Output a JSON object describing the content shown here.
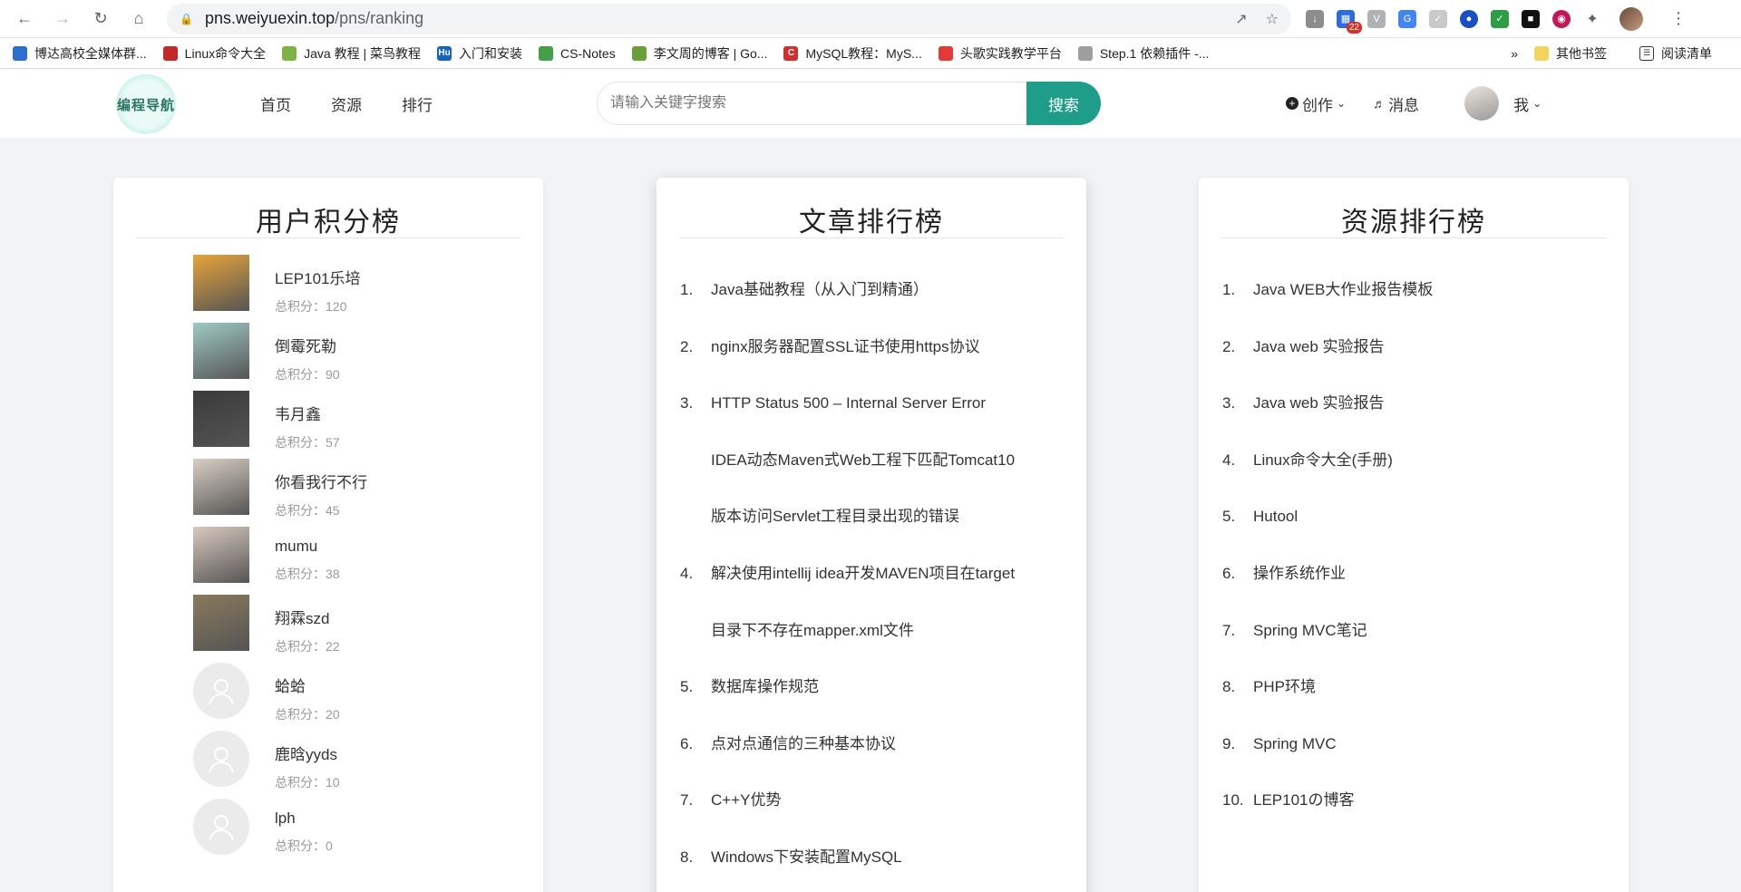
{
  "browser": {
    "url_host": "pns.weiyuexin.top",
    "url_path": "/pns/ranking",
    "badge_count": "22",
    "bookmarks": [
      {
        "label": "博达高校全媒体群...",
        "color": "#2c6fd1"
      },
      {
        "label": "Linux命令大全",
        "color": "#c62828"
      },
      {
        "label": "Java 教程 | 菜鸟教程",
        "color": "#7cb342"
      },
      {
        "label": "入门和安装",
        "color": "#1565c0",
        "mark": "Hu"
      },
      {
        "label": "CS-Notes",
        "color": "#43a047"
      },
      {
        "label": "李文周的博客 | Go...",
        "color": "#689f38"
      },
      {
        "label": "MySQL教程：MyS...",
        "color": "#d32f2f",
        "mark": "C"
      },
      {
        "label": "头歌实践教学平台",
        "color": "#e53935"
      },
      {
        "label": "Step.1 依赖插件 -...",
        "color": "#9e9e9e"
      }
    ],
    "more_bookmarks": "»",
    "other_bookmarks": "其他书签",
    "reading_list": "阅读清单"
  },
  "header": {
    "logo_text": "编程导航",
    "nav": [
      "首页",
      "资源",
      "排行"
    ],
    "search_placeholder": "请输入关键字搜索",
    "search_button": "搜索",
    "create_label": "创作",
    "message_label": "消息",
    "me_label": "我"
  },
  "user_panel": {
    "title": "用户积分榜",
    "score_prefix": "总积分：",
    "users": [
      {
        "name": "LEP101乐培",
        "score": "120",
        "avatar": "photo"
      },
      {
        "name": "倒霉死勒",
        "score": "90",
        "avatar": "photo"
      },
      {
        "name": "韦月鑫",
        "score": "57",
        "avatar": "photo"
      },
      {
        "name": "你看我行不行",
        "score": "45",
        "avatar": "photo"
      },
      {
        "name": "mumu",
        "score": "38",
        "avatar": "photo"
      },
      {
        "name": "翔霖szd",
        "score": "22",
        "avatar": "photo"
      },
      {
        "name": "蛤蛤",
        "score": "20",
        "avatar": "default"
      },
      {
        "name": "鹿晗yyds",
        "score": "10",
        "avatar": "default"
      },
      {
        "name": "lph",
        "score": "0",
        "avatar": "default"
      }
    ]
  },
  "article_panel": {
    "title": "文章排行榜",
    "items": [
      {
        "num": "1.",
        "lines": [
          "Java基础教程（从入门到精通）"
        ]
      },
      {
        "num": "2.",
        "lines": [
          "nginx服务器配置SSL证书使用https协议"
        ]
      },
      {
        "num": "3.",
        "lines": [
          "HTTP Status 500 – Internal Server Error",
          "IDEA动态Maven式Web工程下匹配Tomcat10",
          "版本访问Servlet工程目录出现的错误"
        ]
      },
      {
        "num": "4.",
        "lines": [
          "解决使用intellij idea开发MAVEN项目在target",
          "目录下不存在mapper.xml文件"
        ]
      },
      {
        "num": "5.",
        "lines": [
          "数据库操作规范"
        ]
      },
      {
        "num": "6.",
        "lines": [
          "点对点通信的三种基本协议"
        ]
      },
      {
        "num": "7.",
        "lines": [
          "C++Y优势"
        ]
      },
      {
        "num": "8.",
        "lines": [
          "Windows下安装配置MySQL"
        ]
      }
    ]
  },
  "resource_panel": {
    "title": "资源排行榜",
    "items": [
      {
        "num": "1.",
        "lines": [
          "Java WEB大作业报告模板"
        ]
      },
      {
        "num": "2.",
        "lines": [
          "Java web 实验报告"
        ]
      },
      {
        "num": "3.",
        "lines": [
          "Java web 实验报告"
        ]
      },
      {
        "num": "4.",
        "lines": [
          "Linux命令大全(手册)"
        ]
      },
      {
        "num": "5.",
        "lines": [
          "Hutool"
        ]
      },
      {
        "num": "6.",
        "lines": [
          "操作系统作业"
        ]
      },
      {
        "num": "7.",
        "lines": [
          "Spring MVC笔记"
        ]
      },
      {
        "num": "8.",
        "lines": [
          "PHP环境"
        ]
      },
      {
        "num": "9.",
        "lines": [
          "Spring MVC"
        ]
      },
      {
        "num": "10.",
        "lines": [
          "LEP101の博客"
        ]
      }
    ]
  },
  "colors": {
    "accent": "#1e9d8b",
    "page_bg": "#f1f3f4"
  }
}
